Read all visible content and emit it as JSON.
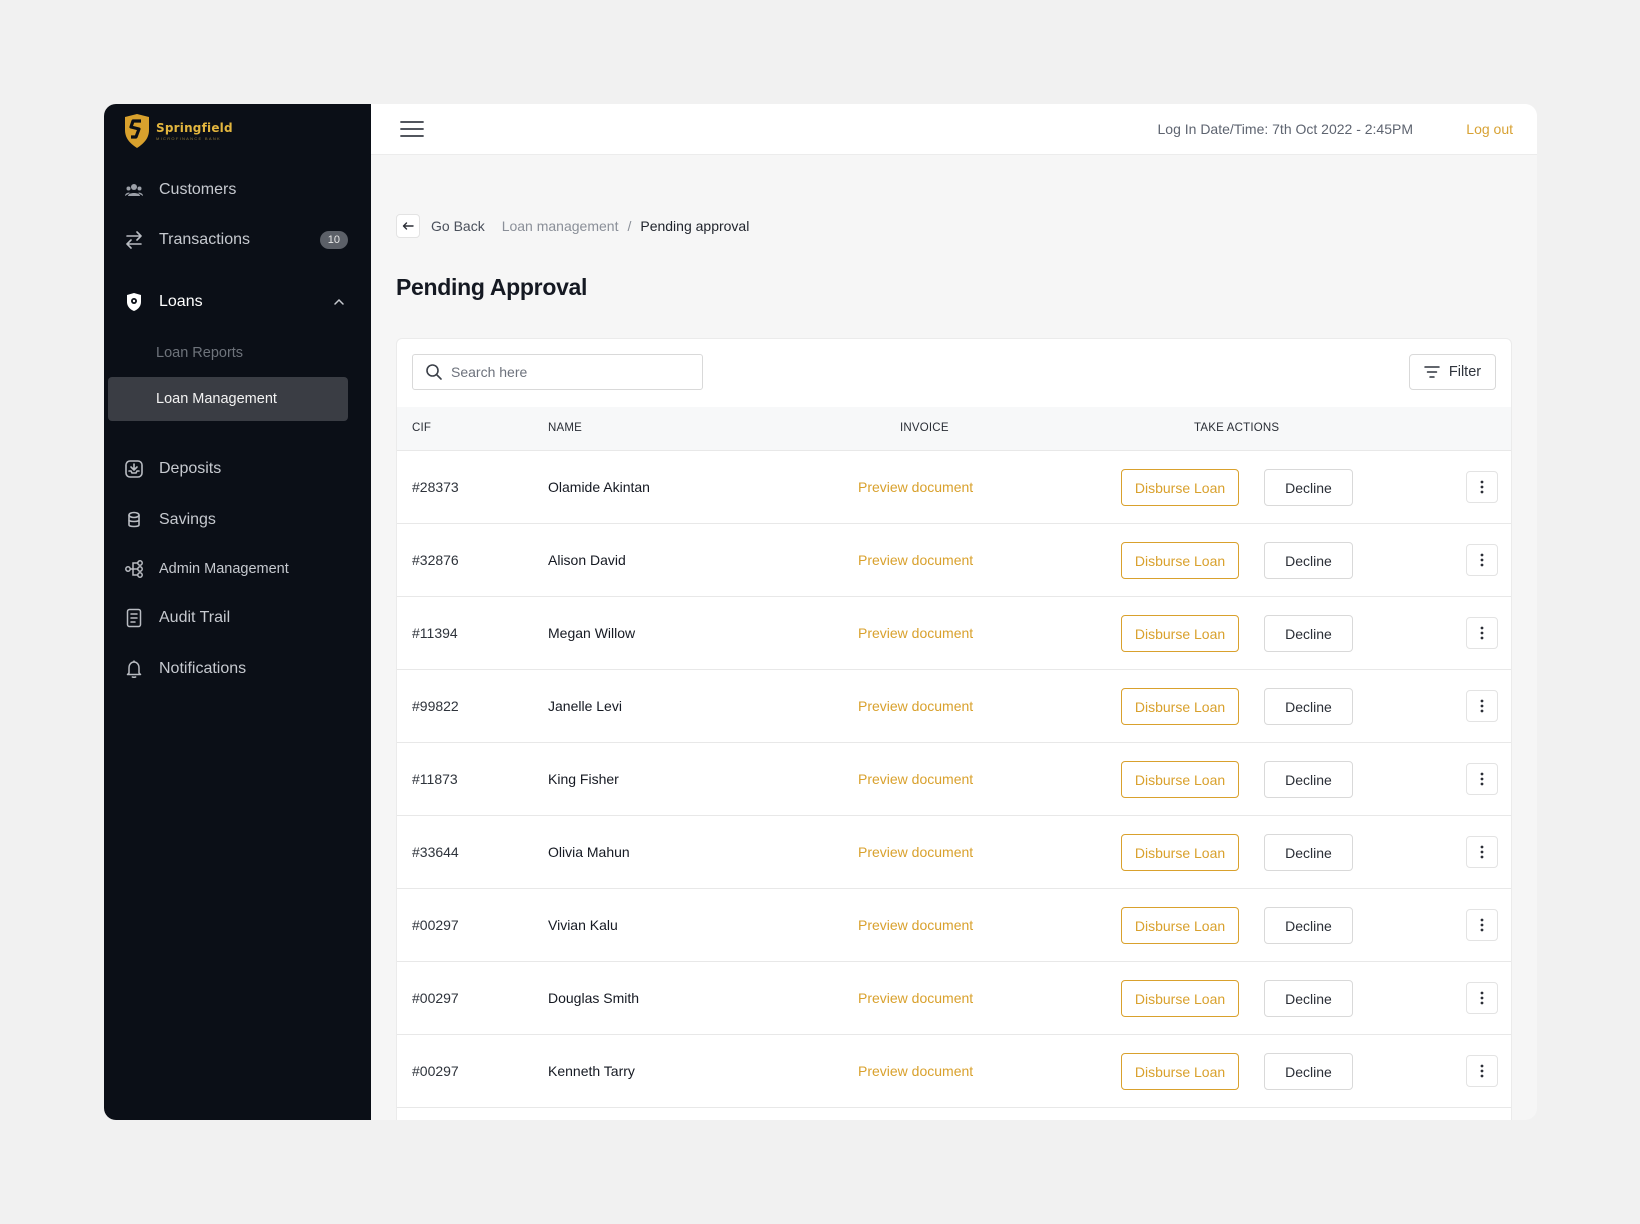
{
  "brand": {
    "name": "Springfield",
    "subtitle": "MICROFINANCE BANK",
    "accent": "#d9a12d"
  },
  "sidebar": {
    "items": [
      {
        "label": "Customers",
        "icon": "users-icon"
      },
      {
        "label": "Transactions",
        "icon": "transfer-arrows-icon",
        "badge": "10"
      },
      {
        "label": "Loans",
        "icon": "loan-shield-icon",
        "expanded": true,
        "children": [
          {
            "label": "Loan Reports"
          },
          {
            "label": "Loan Management",
            "selected": true
          }
        ]
      },
      {
        "label": "Deposits",
        "icon": "deposit-tray-icon"
      },
      {
        "label": "Savings",
        "icon": "coin-stack-icon"
      },
      {
        "label": "Admin Management",
        "icon": "hierarchy-icon"
      },
      {
        "label": "Audit Trail",
        "icon": "document-list-icon"
      },
      {
        "label": "Notifications",
        "icon": "bell-icon"
      }
    ]
  },
  "topbar": {
    "login_time": "Log In Date/Time: 7th Oct 2022 - 2:45PM",
    "logout_label": "Log out"
  },
  "breadcrumb": {
    "back_label": "Go Back",
    "parent": "Loan management",
    "separator": "/",
    "current": "Pending approval"
  },
  "page_title": "Pending Approval",
  "search": {
    "placeholder": "Search here",
    "value": ""
  },
  "filter_label": "Filter",
  "table": {
    "headers": {
      "cif": "CIF",
      "name": "NAME",
      "invoice": "INVOICE",
      "actions": "TAKE ACTIONS"
    },
    "rows": [
      {
        "cif": "#28373",
        "name": "Olamide Akintan",
        "invoice": "Preview document",
        "disburse": "Disburse Loan",
        "decline": "Decline"
      },
      {
        "cif": "#32876",
        "name": "Alison David",
        "invoice": "Preview document",
        "disburse": "Disburse Loan",
        "decline": "Decline"
      },
      {
        "cif": "#11394",
        "name": "Megan Willow",
        "invoice": "Preview document",
        "disburse": "Disburse Loan",
        "decline": "Decline"
      },
      {
        "cif": "#99822",
        "name": "Janelle Levi",
        "invoice": "Preview document",
        "disburse": "Disburse Loan",
        "decline": "Decline"
      },
      {
        "cif": "#11873",
        "name": "King Fisher",
        "invoice": "Preview document",
        "disburse": "Disburse Loan",
        "decline": "Decline"
      },
      {
        "cif": "#33644",
        "name": "Olivia Mahun",
        "invoice": "Preview document",
        "disburse": "Disburse Loan",
        "decline": "Decline"
      },
      {
        "cif": "#00297",
        "name": "Vivian Kalu",
        "invoice": "Preview document",
        "disburse": "Disburse Loan",
        "decline": "Decline"
      },
      {
        "cif": "#00297",
        "name": "Douglas Smith",
        "invoice": "Preview document",
        "disburse": "Disburse Loan",
        "decline": "Decline"
      },
      {
        "cif": "#00297",
        "name": "Kenneth Tarry",
        "invoice": "Preview document",
        "disburse": "Disburse Loan",
        "decline": "Decline"
      }
    ]
  }
}
